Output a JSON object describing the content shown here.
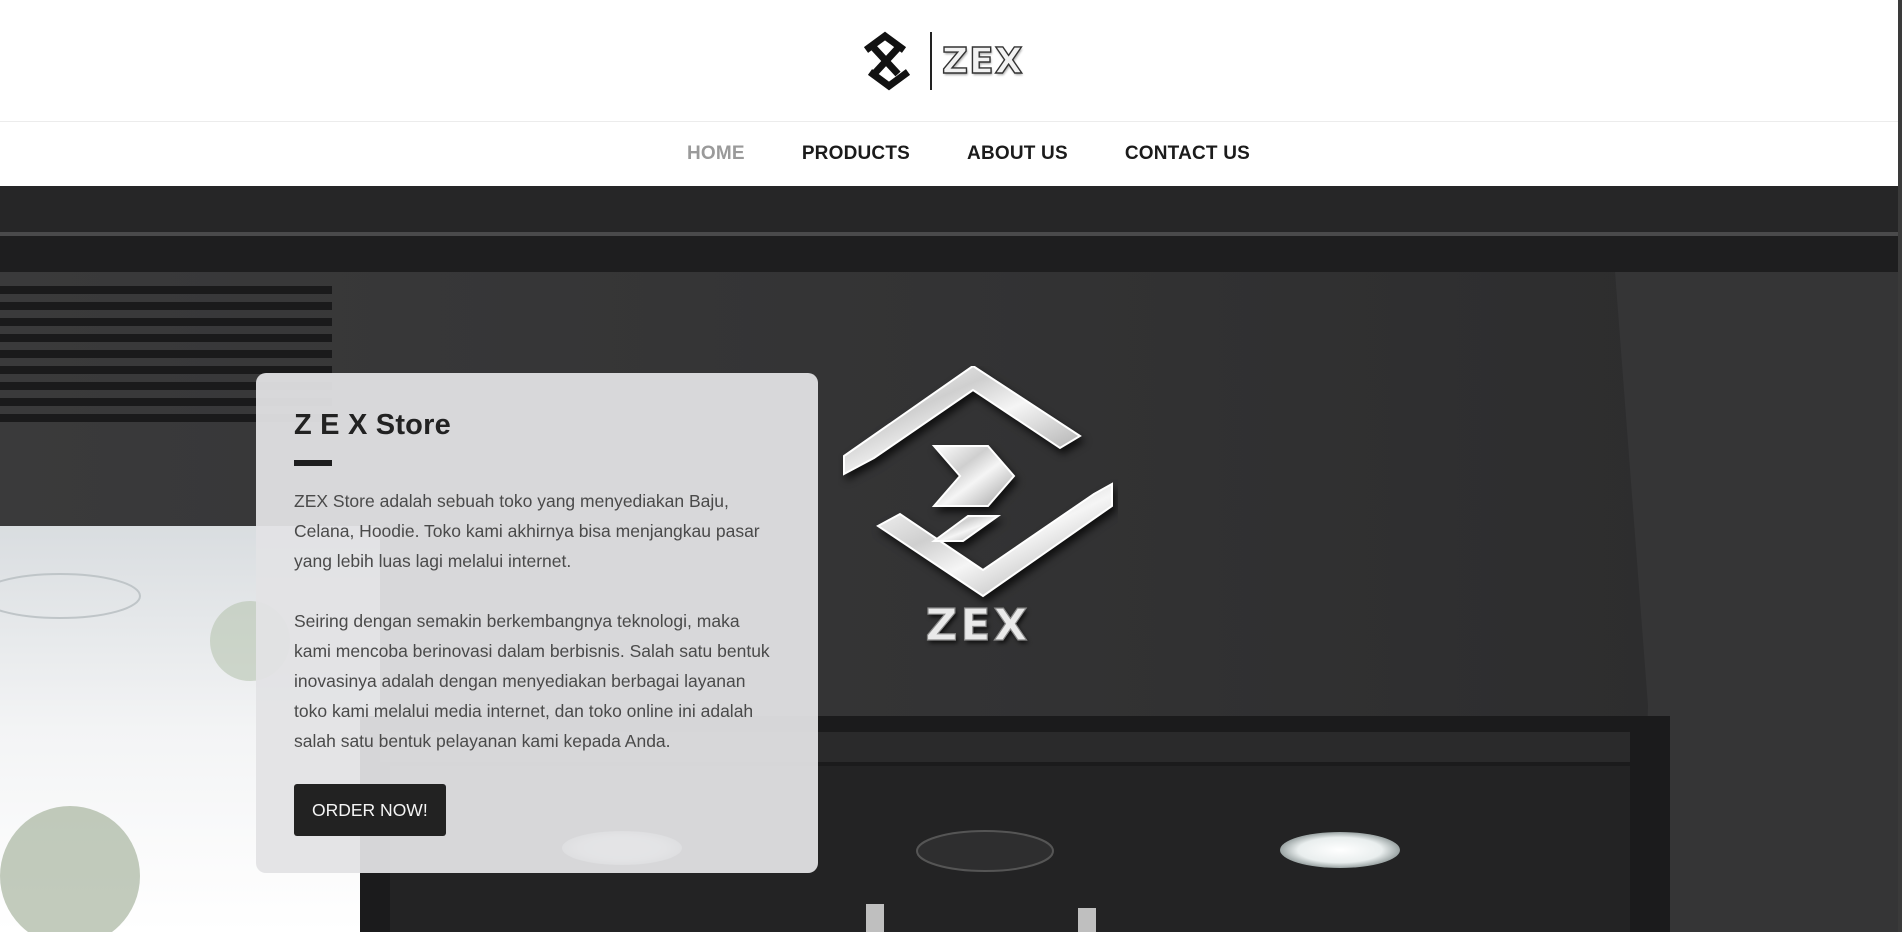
{
  "brand": {
    "logo_icon": "zex-monogram-icon",
    "logo_text": "ZEX"
  },
  "nav": {
    "items": [
      {
        "label": "HOME",
        "active": true
      },
      {
        "label": "PRODUCTS",
        "active": false
      },
      {
        "label": "ABOUT US",
        "active": false
      },
      {
        "label": "CONTACT US",
        "active": false
      }
    ]
  },
  "hero": {
    "sign_logo_icon": "zex-sign-icon",
    "sign_text": "ZEX",
    "card": {
      "title": "Z E X Store",
      "paragraph1": "ZEX Store adalah sebuah toko yang menyediakan Baju, Celana, Hoodie. Toko kami akhirnya bisa menjangkau pasar yang lebih luas lagi melalui internet.",
      "paragraph2": "Seiring dengan semakin berkembangnya teknologi, maka kami mencoba berinovasi dalam berbisnis. Salah satu bentuk inovasinya adalah dengan menyediakan berbagai layanan toko kami melalui media internet, dan toko online ini adalah salah satu bentuk pelayanan kami kepada Anda.",
      "button_label": "ORDER NOW!"
    }
  },
  "colors": {
    "nav_active": "#9a9a9a",
    "nav_text": "#1b1b1b",
    "button_bg": "#222222",
    "card_bg": "#e2e2e4",
    "storefront": "#2c2c2d"
  }
}
